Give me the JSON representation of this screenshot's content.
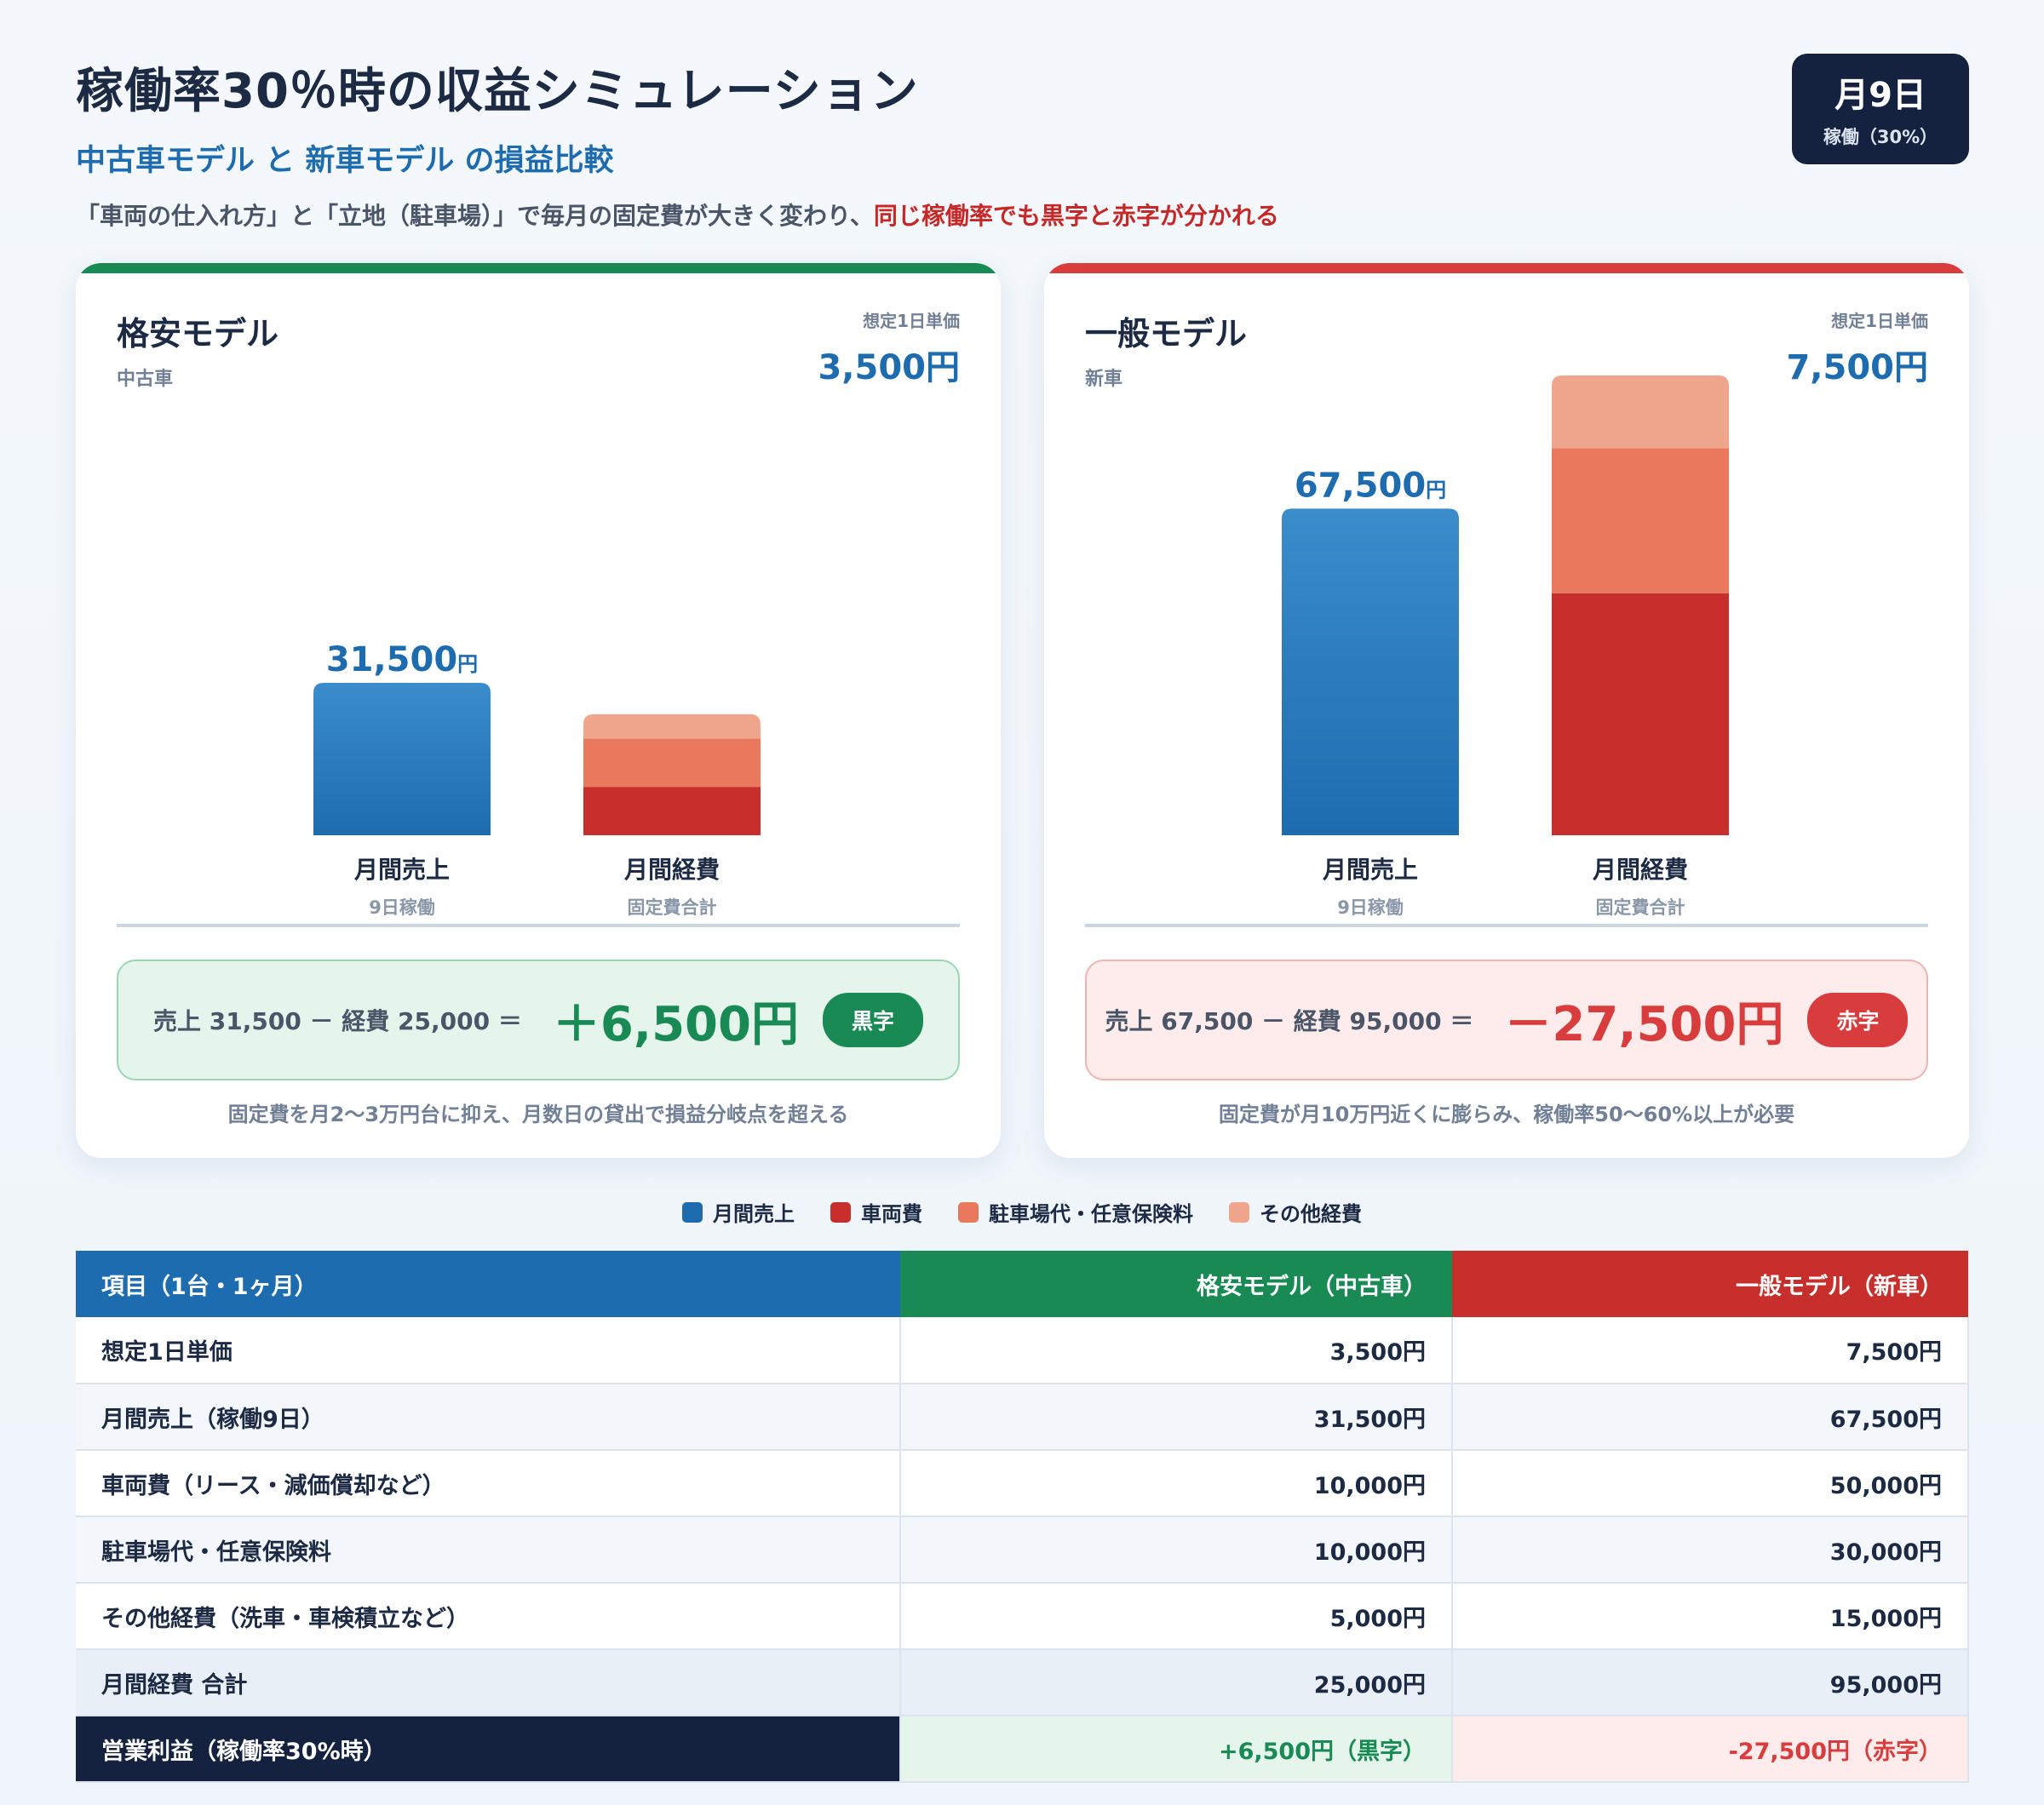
{
  "header": {
    "title": "稼働率30％時の収益シミュレーション",
    "subtitle": "中古車モデル と 新車モデル の損益比較",
    "lead_plain": "「車両の仕入れ方」と「立地（駐車場）」で毎月の固定費が大きく変わり、",
    "lead_highlight": "同じ稼働率でも黒字と赤字が分かれる"
  },
  "badge": {
    "main": "月9日",
    "sub": "稼働（30%）"
  },
  "colors": {
    "revenue": "#1e6cb0",
    "vehicle": "#c62f2b",
    "parking": "#e8795d",
    "other": "#f0a68c",
    "green": "#1a8a55",
    "red": "#d93c3c",
    "navy": "#14223f"
  },
  "panels": {
    "budget": {
      "title": "格安モデル",
      "sub": "中古車",
      "price_label": "想定1日単価",
      "price": "3,500円",
      "formula": "売上 31,500 － 経費 25,000 ＝",
      "profit": "＋6,500円",
      "tag": "黒字",
      "note": "固定費を月2〜3万円台に抑え、月数日の貸出で損益分岐点を超える"
    },
    "standard": {
      "title": "一般モデル",
      "sub": "新車",
      "price_label": "想定1日単価",
      "price": "7,500円",
      "formula": "売上 67,500 － 経費 95,000 ＝",
      "profit": "－27,500円",
      "tag": "赤字",
      "note": "固定費が月10万円近くに膨らみ、稼働率50〜60%以上が必要"
    }
  },
  "chart_data": [
    {
      "type": "bar",
      "categories": [
        "月間売上",
        "月間経費"
      ],
      "category_subs": [
        "9日稼働",
        "固定費合計"
      ],
      "series": [
        {
          "name": "月間売上",
          "values": [
            31500,
            null
          ]
        },
        {
          "name": "車両費",
          "values": [
            null,
            10000
          ]
        },
        {
          "name": "駐車場代・任意保険料",
          "values": [
            null,
            10000
          ]
        },
        {
          "name": "その他経費",
          "values": [
            null,
            5000
          ]
        }
      ],
      "value_label": "31,500",
      "unit": "円",
      "stacked": true,
      "ylim": [
        0,
        100000
      ]
    },
    {
      "type": "bar",
      "categories": [
        "月間売上",
        "月間経費"
      ],
      "category_subs": [
        "9日稼働",
        "固定費合計"
      ],
      "series": [
        {
          "name": "月間売上",
          "values": [
            67500,
            null
          ]
        },
        {
          "name": "車両費",
          "values": [
            null,
            50000
          ]
        },
        {
          "name": "駐車場代・任意保険料",
          "values": [
            null,
            30000
          ]
        },
        {
          "name": "その他経費",
          "values": [
            null,
            15000
          ]
        }
      ],
      "value_label": "67,500",
      "unit": "円",
      "stacked": true,
      "ylim": [
        0,
        100000
      ]
    }
  ],
  "legend": [
    {
      "label": "月間売上",
      "color": "#1e6cb0"
    },
    {
      "label": "車両費",
      "color": "#c62f2b"
    },
    {
      "label": "駐車場代・任意保険料",
      "color": "#e8795d"
    },
    {
      "label": "その他経費",
      "color": "#f0a68c"
    }
  ],
  "table": {
    "headers": [
      "項目（1台・1ヶ月）",
      "格安モデル（中古車）",
      "一般モデル（新車）"
    ],
    "rows": [
      [
        "想定1日単価",
        "3,500円",
        "7,500円"
      ],
      [
        "月間売上（稼働9日）",
        "31,500円",
        "67,500円"
      ],
      [
        "車両費（リース・減価償却など）",
        "10,000円",
        "50,000円"
      ],
      [
        "駐車場代・任意保険料",
        "10,000円",
        "30,000円"
      ],
      [
        "その他経費（洗車・車検積立など）",
        "5,000円",
        "15,000円"
      ],
      [
        "月間経費 合計",
        "25,000円",
        "95,000円"
      ]
    ],
    "footer": [
      "営業利益（稼働率30%時）",
      "+6,500円（黒字）",
      "-27,500円（赤字）"
    ]
  }
}
